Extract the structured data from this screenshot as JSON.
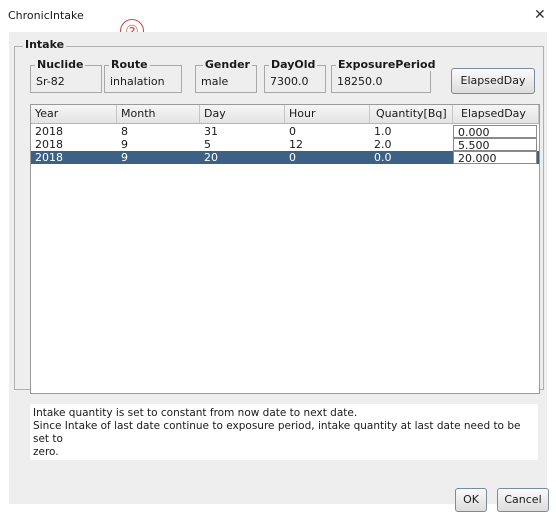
{
  "window": {
    "title": "ChronicIntake",
    "annotation_marker": "②"
  },
  "intake": {
    "group_label": "Intake",
    "fields": [
      {
        "label": "Nuclide",
        "value": "Sr-82"
      },
      {
        "label": "Route",
        "value": "inhalation"
      },
      {
        "label": "Gender",
        "value": "male"
      },
      {
        "label": "DayOld",
        "value": "7300.0"
      },
      {
        "label": "ExposurePeriod",
        "value": "18250.0"
      }
    ],
    "elapsed_button": "ElapsedDay"
  },
  "table": {
    "headers": [
      "Year",
      "Month",
      "Day",
      "Hour",
      "Quantity[Bq]",
      "ElapsedDay"
    ],
    "rows": [
      [
        "2018",
        "8",
        "31",
        "0",
        "1.0",
        "0.000"
      ],
      [
        "2018",
        "9",
        "5",
        "12",
        "2.0",
        "5.500"
      ],
      [
        "2018",
        "9",
        "20",
        "0",
        "0.0",
        "20.000"
      ]
    ],
    "selected_row": 2,
    "selected_color": "#3d6185"
  },
  "note": {
    "lines": [
      "Intake quantity is set to constant from now date to next date.",
      "Since Intake of last date continue  to exposure period, intake quantity at last date need to be set to",
      "zero."
    ]
  },
  "buttons": {
    "ok": "OK",
    "cancel": "Cancel"
  }
}
